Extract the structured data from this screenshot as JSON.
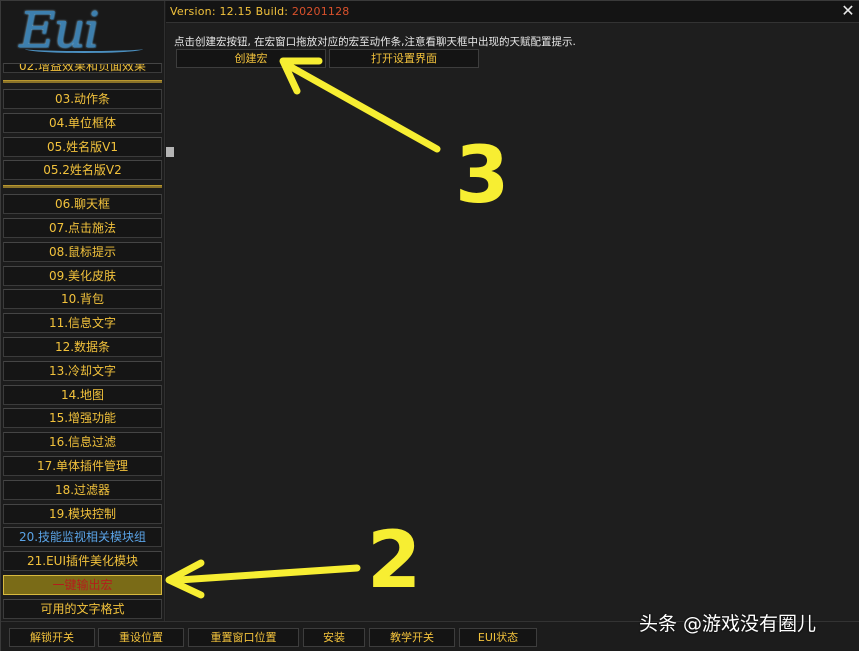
{
  "app": {
    "logo_text": "Eui",
    "version_label": "Version:",
    "version_number": "12.15",
    "build_label": "Build:",
    "build_number": "20201128",
    "close_symbol": "✕"
  },
  "sidebar": {
    "partial_item": "02.增益效果和负面效果",
    "items": [
      {
        "label": "03.动作条"
      },
      {
        "label": "04.单位框体"
      },
      {
        "label": "05.姓名版V1"
      },
      {
        "label": "05.2姓名版V2"
      },
      {
        "label": "06.聊天框"
      },
      {
        "label": "07.点击施法"
      },
      {
        "label": "08.鼠标提示"
      },
      {
        "label": "09.美化皮肤"
      },
      {
        "label": "10.背包"
      },
      {
        "label": "11.信息文字"
      },
      {
        "label": "12.数据条"
      },
      {
        "label": "13.冷却文字"
      },
      {
        "label": "14.地图"
      },
      {
        "label": "15.增强功能"
      },
      {
        "label": "16.信息过滤"
      },
      {
        "label": "17.单体插件管理"
      },
      {
        "label": "18.过滤器"
      },
      {
        "label": "19.模块控制"
      },
      {
        "label": "20.技能监视相关模块组"
      },
      {
        "label": "21.EUI插件美化模块"
      },
      {
        "label": "一键输出宏"
      },
      {
        "label": "可用的文字格式"
      }
    ]
  },
  "main": {
    "hint": "点击创建宏按钮, 在宏窗口拖放对应的宏至动作条,注意看聊天框中出现的天赋配置提示.",
    "create_macro_label": "创建宏",
    "open_settings_label": "打开设置界面"
  },
  "bottom_bar": {
    "buttons": [
      {
        "label": "解锁开关"
      },
      {
        "label": "重设位置"
      },
      {
        "label": "重置窗口位置"
      },
      {
        "label": "安装"
      },
      {
        "label": "教学开关"
      },
      {
        "label": "EUI状态"
      }
    ]
  },
  "annotations": {
    "marker_3": "3",
    "marker_2": "2",
    "arrow_color": "#f7ee32"
  },
  "watermark": "头条 @游戏没有圈儿",
  "colors": {
    "gold_text": "#f2c23c",
    "build_orange": "#d9512c",
    "selected_red": "#b31d1d",
    "blue_item": "#5aa3e6"
  }
}
